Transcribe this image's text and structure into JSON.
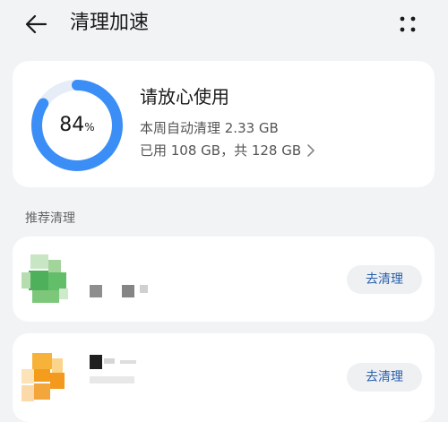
{
  "header": {
    "title": "清理加速",
    "back_icon": "arrow-left-icon",
    "more_icon": "more-dots-icon"
  },
  "storage": {
    "used_percent": 84,
    "percent_value": "84",
    "percent_unit": "%",
    "status": "请放心使用",
    "weekly_cleaned": "本周自动清理 2.33 GB",
    "usage": "已用 108 GB，共 128 GB",
    "ring_color": "#3a8ef6",
    "ring_track_color": "#e6edf7"
  },
  "section": {
    "title": "推荐清理"
  },
  "recommendations": [
    {
      "icon": "green-app-icon",
      "button_label": "去清理"
    },
    {
      "icon": "orange-app-icon",
      "button_label": "去清理"
    }
  ],
  "colors": {
    "accent": "#2a5fad",
    "background": "#f1f3f5",
    "card": "#ffffff",
    "button_bg": "#eef0f2"
  }
}
